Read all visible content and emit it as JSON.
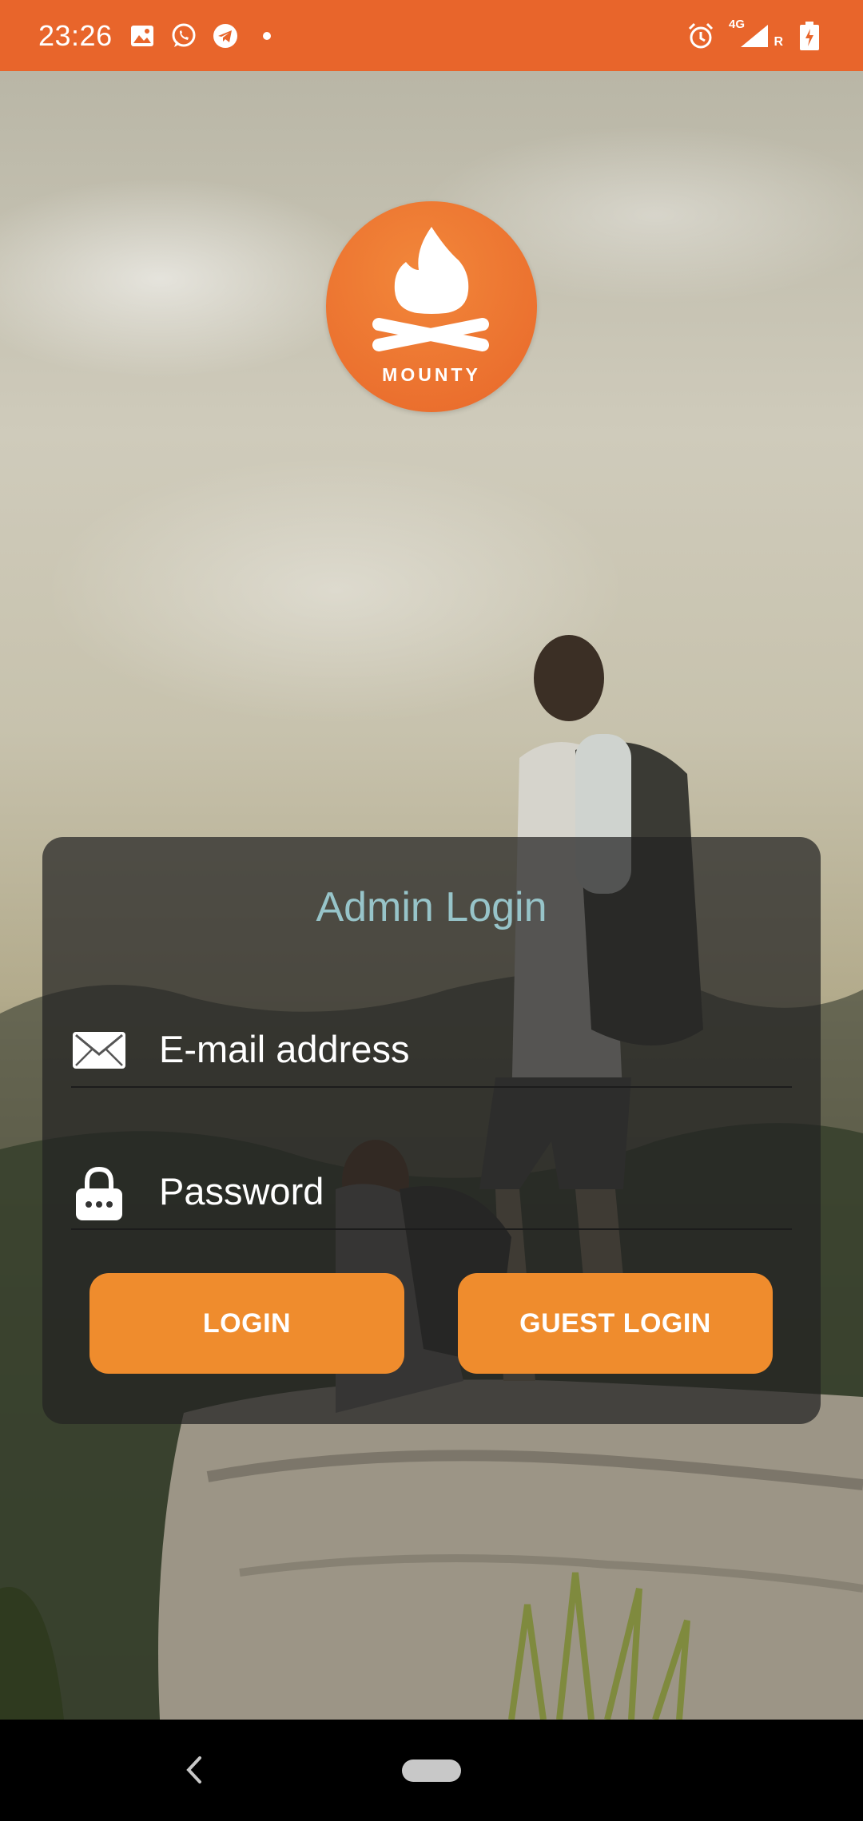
{
  "status_bar": {
    "time": "23:26",
    "left_icons": [
      "image-icon",
      "whatsapp-icon",
      "telegram-icon",
      "dot-icon"
    ],
    "right_icons": [
      "alarm-icon",
      "signal-icon",
      "battery-icon"
    ],
    "network_label": "4G",
    "roaming_label": "R",
    "color": "#e8652b"
  },
  "logo": {
    "text": "MOUNTY",
    "icon": "campfire-icon",
    "color": "#ea6f2c"
  },
  "login": {
    "title": "Admin Login",
    "email_placeholder": "E-mail address",
    "password_placeholder": "Password",
    "login_label": "LOGIN",
    "guest_label": "GUEST LOGIN",
    "button_color": "#ef8c2d",
    "title_color": "#97c4c9"
  },
  "nav_bar": {
    "icons": [
      "back-icon",
      "home-pill-icon"
    ]
  }
}
